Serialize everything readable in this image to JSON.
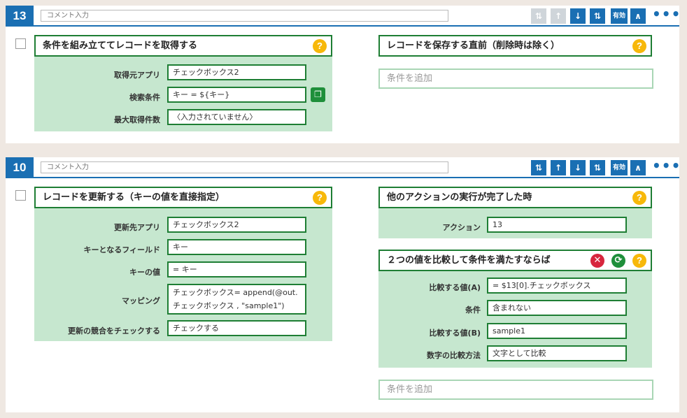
{
  "cards": [
    {
      "number": "13",
      "comment_placeholder": "コメント入力",
      "toolbar": {
        "top": "⇅",
        "up": "↑",
        "down": "↓",
        "bottom": "⇅",
        "enable": "有効",
        "collapse": "∧",
        "more": "•••"
      },
      "action": {
        "title": "条件を組み立ててレコードを取得する",
        "fields": [
          {
            "label": "取得元アプリ",
            "value": "チェックボックス2"
          },
          {
            "label": "検索条件",
            "value": "キー = ${キー}"
          },
          {
            "label": "最大取得件数",
            "value": "〈入力されていません〉"
          }
        ]
      },
      "trigger": {
        "title": "レコードを保存する直前（削除時は除く）"
      },
      "add_condition": "条件を追加"
    },
    {
      "number": "10",
      "comment_placeholder": "コメント入力",
      "toolbar": {
        "top": "⇅",
        "up": "↑",
        "down": "↓",
        "bottom": "⇅",
        "enable": "有効",
        "collapse": "∧",
        "more": "•••"
      },
      "action": {
        "title": "レコードを更新する（キーの値を直接指定）",
        "fields": [
          {
            "label": "更新先アプリ",
            "value": "チェックボックス2"
          },
          {
            "label": "キーとなるフィールド",
            "value": "キー"
          },
          {
            "label": "キーの値",
            "value": "= キー"
          },
          {
            "label": "マッピング",
            "value": "チェックボックス= append(@out.チェックボックス , \"sample1\")"
          },
          {
            "label": "更新の競合をチェックする",
            "value": "チェックする"
          }
        ]
      },
      "trigger": {
        "title": "他のアクションの実行が完了した時",
        "fields": [
          {
            "label": "アクション",
            "value": "13"
          }
        ]
      },
      "condition": {
        "title": "２つの値を比較して条件を満たすならば",
        "fields": [
          {
            "label": "比較する値(A)",
            "value": "= $13[0].チェックボックス"
          },
          {
            "label": "条件",
            "value": "含まれない"
          },
          {
            "label": "比較する値(B)",
            "value": "sample1"
          },
          {
            "label": "数字の比較方法",
            "value": "文字として比較"
          }
        ]
      },
      "add_condition": "条件を追加"
    }
  ],
  "icons": {
    "help": "?",
    "delete": "✕",
    "swap": "⟳",
    "copy": "❐"
  },
  "colors": {
    "accent_blue": "#1a6fb3",
    "action_green": "#1e7e34",
    "panel_green": "#c6e7cf",
    "help_yellow": "#f7b80a",
    "delete_red": "#d7263d"
  }
}
